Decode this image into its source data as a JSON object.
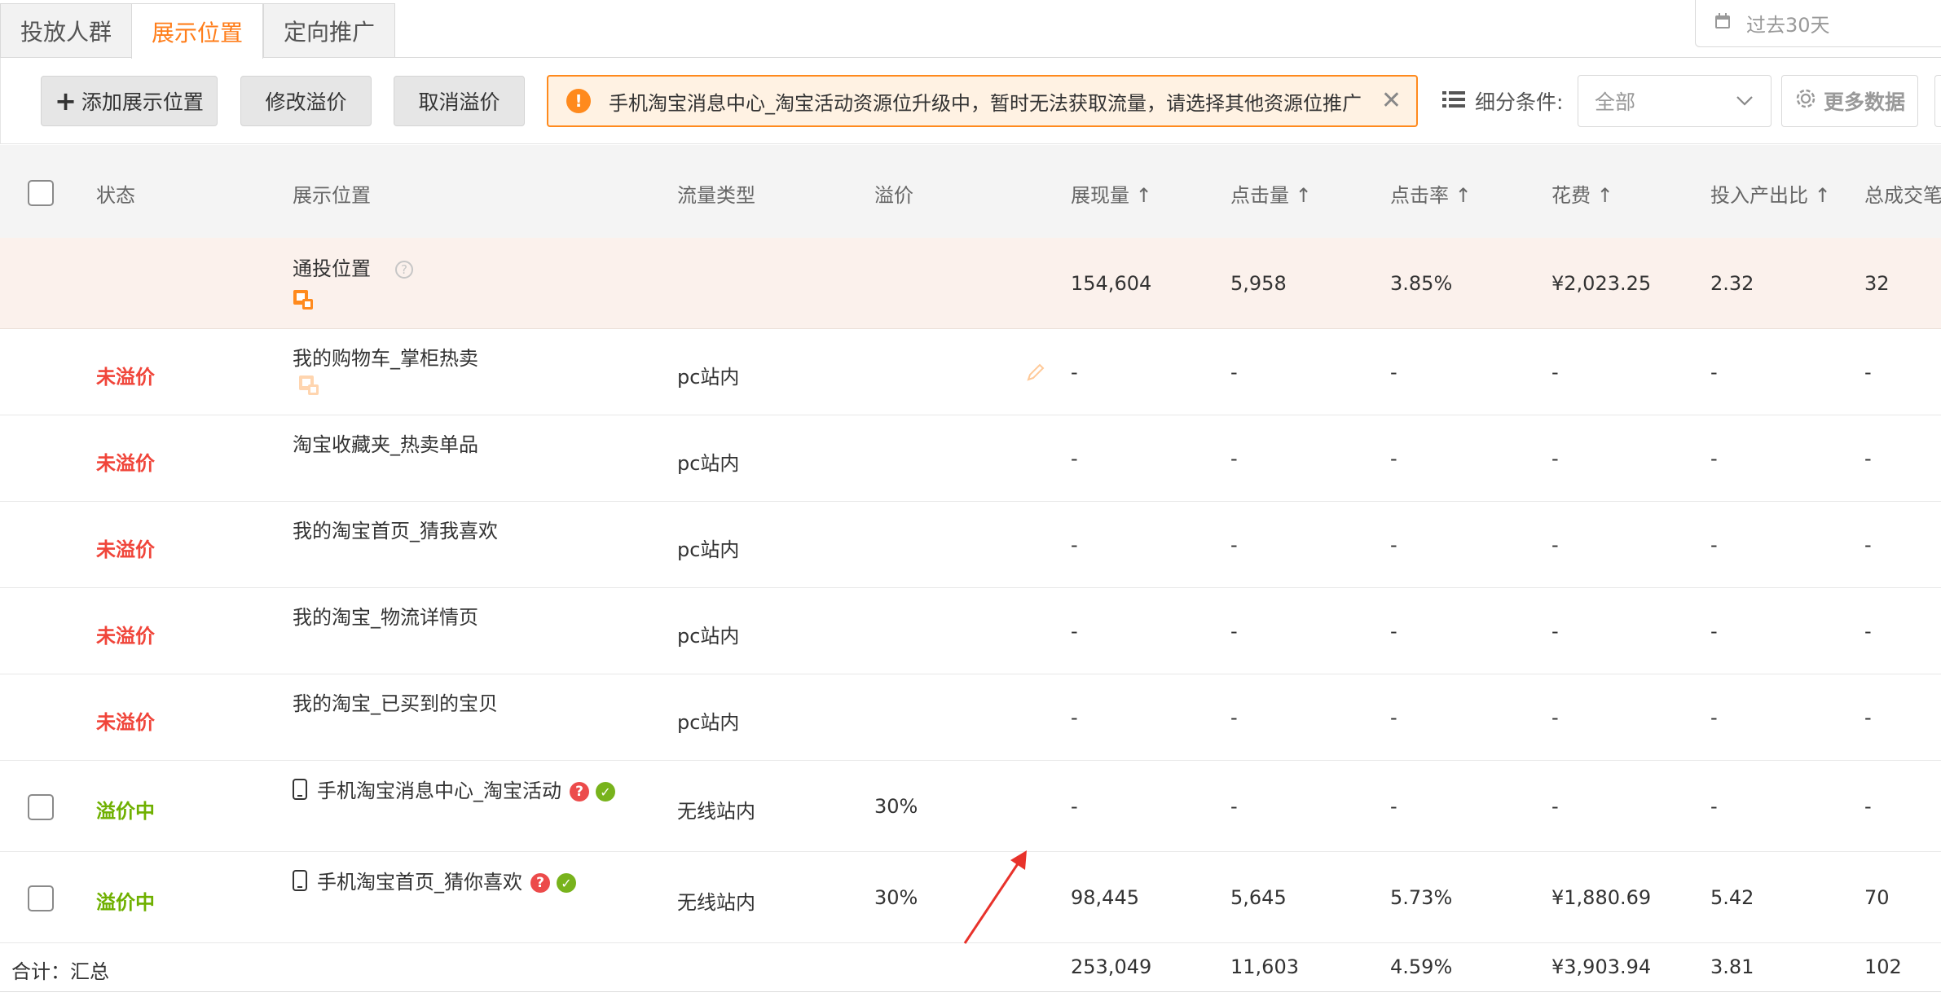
{
  "tabs": [
    "投放人群",
    "展示位置",
    "定向推广"
  ],
  "date_range": "过去30天",
  "toolbar": {
    "add_label": "添加展示位置",
    "modify_label": "修改溢价",
    "cancel_label": "取消溢价",
    "alert_text": "手机淘宝消息中心_淘宝活动资源位升级中，暂时无法获取流量，请选择其他资源位推广",
    "filter_label": "细分条件:",
    "filter_value": "全部",
    "more_data_label": "更多数据"
  },
  "columns": [
    "状态",
    "展示位置",
    "流量类型",
    "溢价",
    "展现量 ↑",
    "点击量 ↑",
    "点击率 ↑",
    "花费 ↑",
    "投入产出比 ↑",
    "总成交笔"
  ],
  "rows": [
    {
      "status": "",
      "position": "通投位置",
      "traffic": "",
      "premium": "",
      "impressions": "154,604",
      "clicks": "5,958",
      "ctr": "3.85%",
      "cost": "¥2,023.25",
      "roi": "2.32",
      "orders": "32"
    },
    {
      "status": "未溢价",
      "position": "我的购物车_掌柜热卖",
      "traffic": "pc站内",
      "premium": "",
      "impressions": "-",
      "clicks": "-",
      "ctr": "-",
      "cost": "-",
      "roi": "-",
      "orders": "-"
    },
    {
      "status": "未溢价",
      "position": "淘宝收藏夹_热卖单品",
      "traffic": "pc站内",
      "premium": "",
      "impressions": "-",
      "clicks": "-",
      "ctr": "-",
      "cost": "-",
      "roi": "-",
      "orders": "-"
    },
    {
      "status": "未溢价",
      "position": "我的淘宝首页_猜我喜欢",
      "traffic": "pc站内",
      "premium": "",
      "impressions": "-",
      "clicks": "-",
      "ctr": "-",
      "cost": "-",
      "roi": "-",
      "orders": "-"
    },
    {
      "status": "未溢价",
      "position": "我的淘宝_物流详情页",
      "traffic": "pc站内",
      "premium": "",
      "impressions": "-",
      "clicks": "-",
      "ctr": "-",
      "cost": "-",
      "roi": "-",
      "orders": "-"
    },
    {
      "status": "未溢价",
      "position": "我的淘宝_已买到的宝贝",
      "traffic": "pc站内",
      "premium": "",
      "impressions": "-",
      "clicks": "-",
      "ctr": "-",
      "cost": "-",
      "roi": "-",
      "orders": "-"
    },
    {
      "status": "溢价中",
      "position": "手机淘宝消息中心_淘宝活动",
      "traffic": "无线站内",
      "premium": "30%",
      "impressions": "-",
      "clicks": "-",
      "ctr": "-",
      "cost": "-",
      "roi": "-",
      "orders": "-"
    },
    {
      "status": "溢价中",
      "position": "手机淘宝首页_猜你喜欢",
      "traffic": "无线站内",
      "premium": "30%",
      "impressions": "98,445",
      "clicks": "5,645",
      "ctr": "5.73%",
      "cost": "¥1,880.69",
      "roi": "5.42",
      "orders": "70"
    }
  ],
  "total": {
    "label": "合计：汇总",
    "impressions": "253,049",
    "clicks": "11,603",
    "ctr": "4.59%",
    "cost": "¥3,903.94",
    "roi": "3.81",
    "orders": "102"
  },
  "colors": {
    "accent": "#ff7e1b",
    "status_off": "#f0453a",
    "status_on": "#6fb000",
    "annotation_arrow": "#e8322b"
  }
}
